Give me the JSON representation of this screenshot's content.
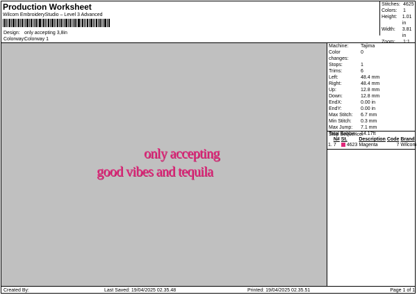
{
  "header": {
    "title": "Production Worksheet",
    "software": "Wilcom EmbroideryStudio – Level 3 Advanced",
    "design_label": "Design:",
    "design_value": "only accepting 3,8in",
    "colorway_label": "Colorway:",
    "colorway_value": "Colorway 1"
  },
  "summary": [
    {
      "label": "Stitches:",
      "value": "4625"
    },
    {
      "label": "Colors:",
      "value": "1"
    },
    {
      "label": "Height:",
      "value": "1.01 in"
    },
    {
      "label": "Width:",
      "value": "3.81 in"
    },
    {
      "label": "Zoom:",
      "value": "1:1"
    }
  ],
  "design_text": {
    "line1": "only accepting",
    "line2": "good vibes and tequila",
    "color": "#e0287a",
    "background": "#c0c0c0"
  },
  "machine_info": [
    {
      "label": "Machine:",
      "value": "Tajima"
    },
    {
      "label": "Color changes:",
      "value": "0"
    },
    {
      "label": "Stops:",
      "value": "1"
    },
    {
      "label": "Trims:",
      "value": "6"
    },
    {
      "label": "Left:",
      "value": "48.4 mm"
    },
    {
      "label": "Right:",
      "value": "48.4 mm"
    },
    {
      "label": "Up:",
      "value": "12.8 mm"
    },
    {
      "label": "Down:",
      "value": "12.8 mm"
    },
    {
      "label": "EndX:",
      "value": "0.00 in"
    },
    {
      "label": "EndY:",
      "value": "0.00 in"
    },
    {
      "label": "Max Stitch:",
      "value": "6.7 mm"
    },
    {
      "label": "Min Stitch:",
      "value": "0.3 mm"
    },
    {
      "label": "Max Jump:",
      "value": "7.1 mm"
    },
    {
      "label": "Total Bobbin:",
      "value": "14.17ft"
    }
  ],
  "stop_sequence": {
    "title": "Stop Sequence:",
    "columns": [
      "N#",
      "St.",
      "Description",
      "Code",
      "Brand"
    ],
    "rows": [
      {
        "index": "1.",
        "n": "7",
        "swatch": "#e0287a",
        "st": "4623",
        "description": "Magenta",
        "code": "7",
        "brand": "Wilcom"
      }
    ]
  },
  "footer": {
    "created": "Created By:",
    "saved": "Last Saved: 19/04/2025 02.35.48",
    "printed": "Printed: 19/04/2025 02.35.51",
    "page": "Page 1 of 1"
  }
}
